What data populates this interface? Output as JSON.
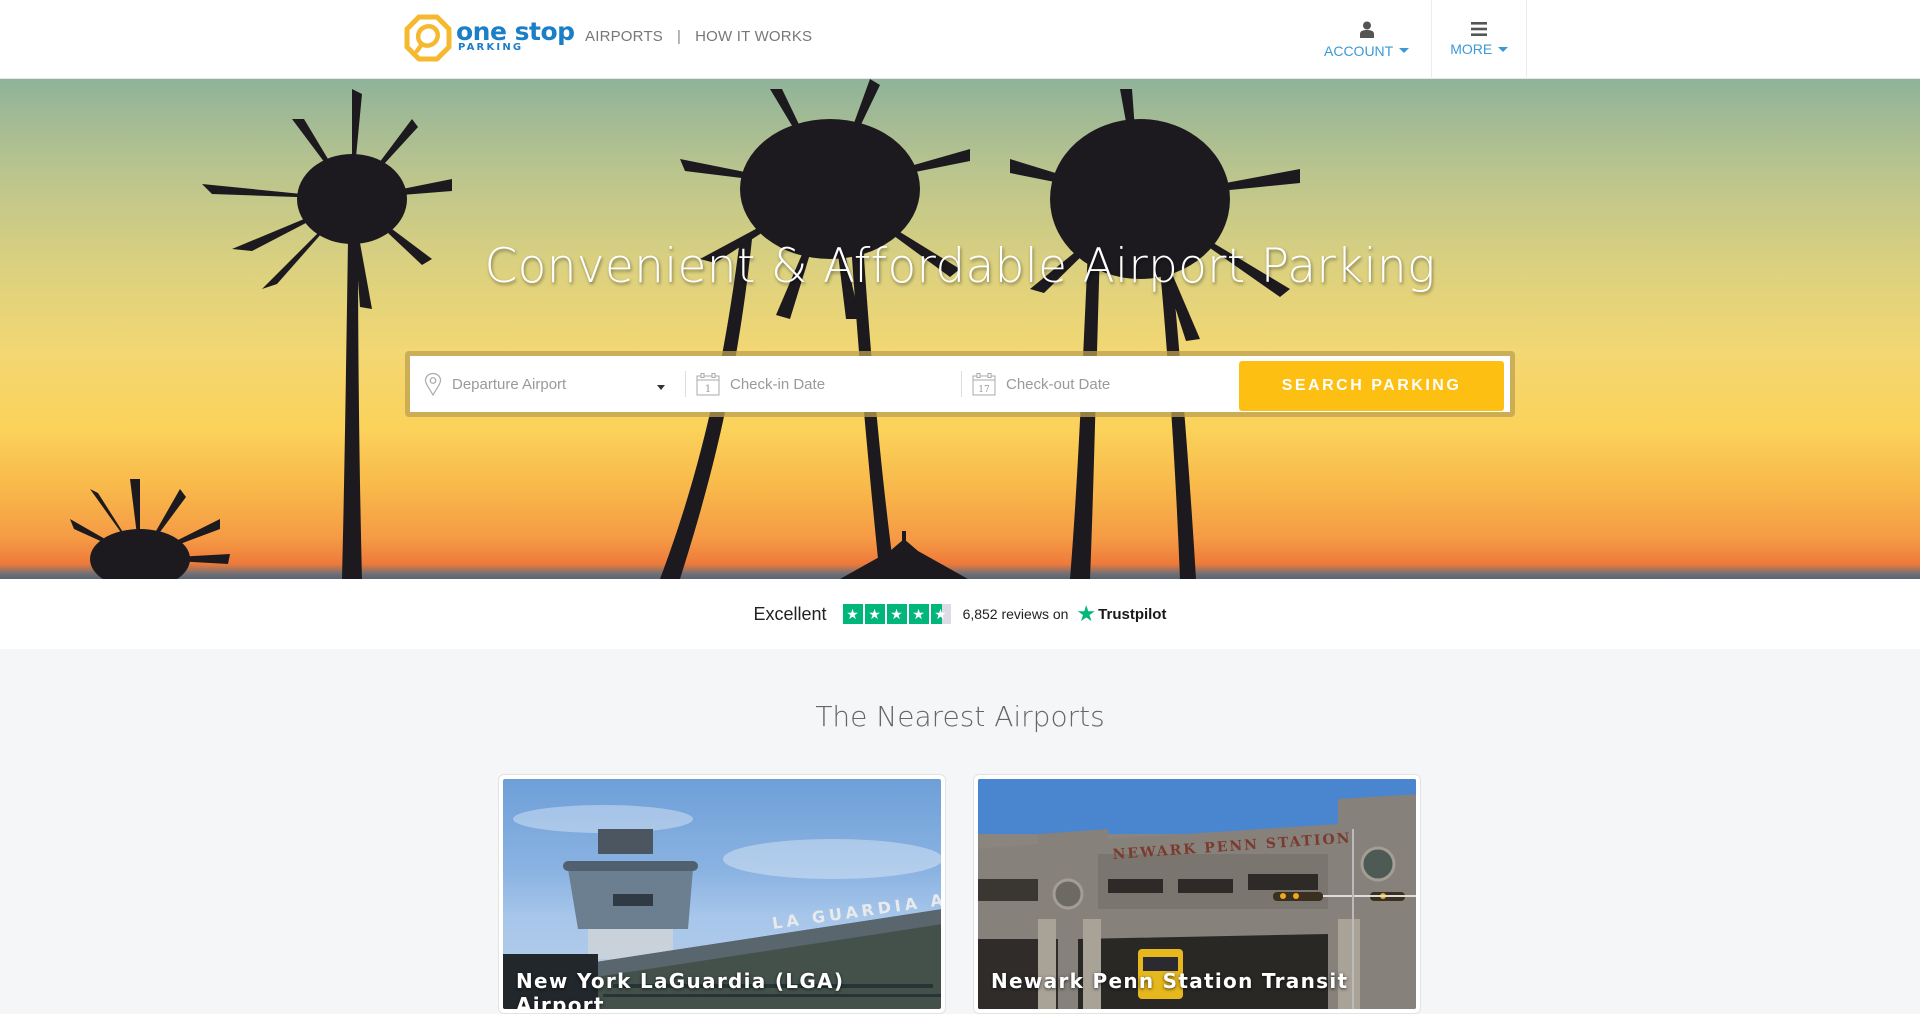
{
  "header": {
    "logo": {
      "main": "one stop",
      "sub": "PARKING",
      "icon": "logo-octagon-icon"
    },
    "nav": [
      {
        "label": "AIRPORTS"
      },
      {
        "label": "|"
      },
      {
        "label": "HOW IT WORKS"
      }
    ],
    "account": {
      "label": "ACCOUNT",
      "icon": "user-icon"
    },
    "more": {
      "label": "MORE",
      "icon": "hamburger-icon"
    }
  },
  "hero": {
    "title": "Convenient & Affordable Airport Parking",
    "search": {
      "departure_placeholder": "Departure Airport",
      "checkin_placeholder": "Check-in Date",
      "checkin_icon_day": "1",
      "checkout_placeholder": "Check-out Date",
      "checkout_icon_day": "17",
      "button_label": "SEARCH PARKING"
    }
  },
  "trustpilot": {
    "rating_label": "Excellent",
    "stars": 4.5,
    "reviews_text": "6,852 reviews on",
    "brand": "Trustpilot",
    "color": "#00b67a"
  },
  "nearest": {
    "title": "The Nearest Airports",
    "cards": [
      {
        "name": "New York LaGuardia (LGA) Airport",
        "sign_text": "LA GUARDIA   AIRPORT"
      },
      {
        "name": "Newark Penn Station Transit",
        "sign_text": "NEWARK PENN STATION"
      }
    ]
  },
  "colors": {
    "brand_blue": "#1b7fc7",
    "brand_yellow": "#f5b82e",
    "search_button": "#fdbf12",
    "link_blue": "#3b9ad6"
  }
}
